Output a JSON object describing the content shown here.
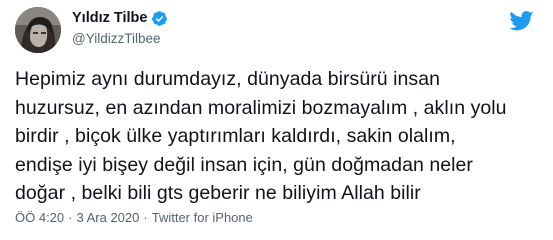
{
  "user": {
    "display_name": "Yıldız Tilbe",
    "handle": "@YildizzTilbee",
    "verified_icon": "verified-badge-icon",
    "avatar_icon": "profile-avatar"
  },
  "brand": {
    "logo_icon": "twitter-bird-icon",
    "color": "#1d9bf0"
  },
  "tweet": {
    "text": "Hepimiz aynı durumdayız, dünyada birsürü insan\nhuzursuz, en azından moralimizi bozmayalım , aklın yolu\nbirdir , biçok ülke yaptırımları kaldırdı, sakin olalım,\nendişe iyi bişey değil insan için, gün doğmadan neler\ndoğar , belki bili gts geberir ne biliyim Allah bilir"
  },
  "meta": {
    "time": "ÖÖ 4:20",
    "separator": "·",
    "date": "3 Ara 2020",
    "source": "Twitter for iPhone"
  },
  "colors": {
    "text_primary": "#0f1419",
    "text_secondary": "#536471",
    "accent": "#1d9bf0"
  }
}
